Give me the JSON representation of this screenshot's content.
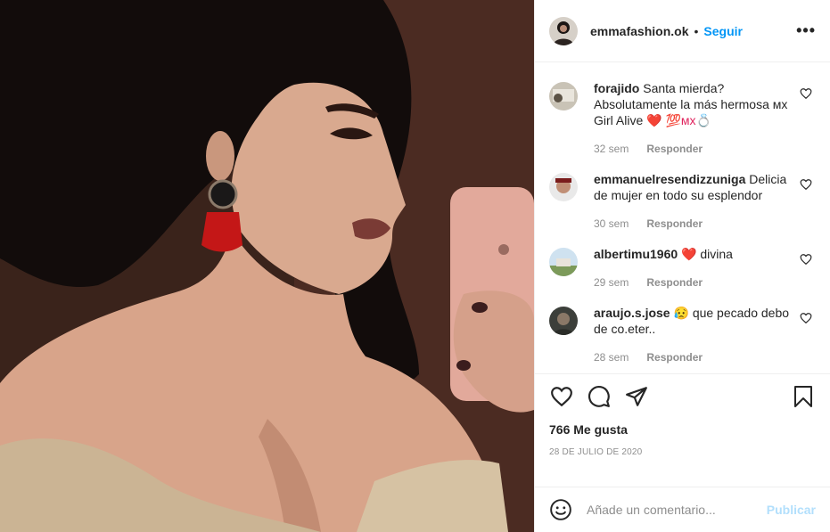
{
  "post": {
    "image_alt": "",
    "username": "emmafashion.ok",
    "separator": "•",
    "follow_label": "Seguir",
    "more_label": "•••"
  },
  "comments": [
    {
      "username": "forajido",
      "text": "Santa mierda? Absolutamente la más hermosa ᴍx Girl Alive",
      "emoji": "❤️ 💯ᴍx💍",
      "time": "32 sem",
      "reply": "Responder"
    },
    {
      "username": "emmanuelresendizzuniga",
      "text": "Delicia de mujer en todo su esplendor",
      "emoji": "",
      "time": "30 sem",
      "reply": "Responder"
    },
    {
      "username": "albertimu1960",
      "text": "divina",
      "emoji": "❤️",
      "time": "29 sem",
      "reply": "Responder"
    },
    {
      "username": "araujo.s.jose",
      "text": "que pecado debo de co.eter..",
      "emoji": "😥",
      "time": "28 sem",
      "reply": "Responder"
    }
  ],
  "actions": {
    "likes": "766 Me gusta",
    "date": "28 DE JULIO DE 2020"
  },
  "compose": {
    "placeholder": "Añade un comentario...",
    "publish_label": "Publicar"
  },
  "colors": {
    "accent": "#0095f6",
    "publish_disabled": "#b2dffc",
    "muted": "#8e8e8e",
    "text": "#262626"
  }
}
